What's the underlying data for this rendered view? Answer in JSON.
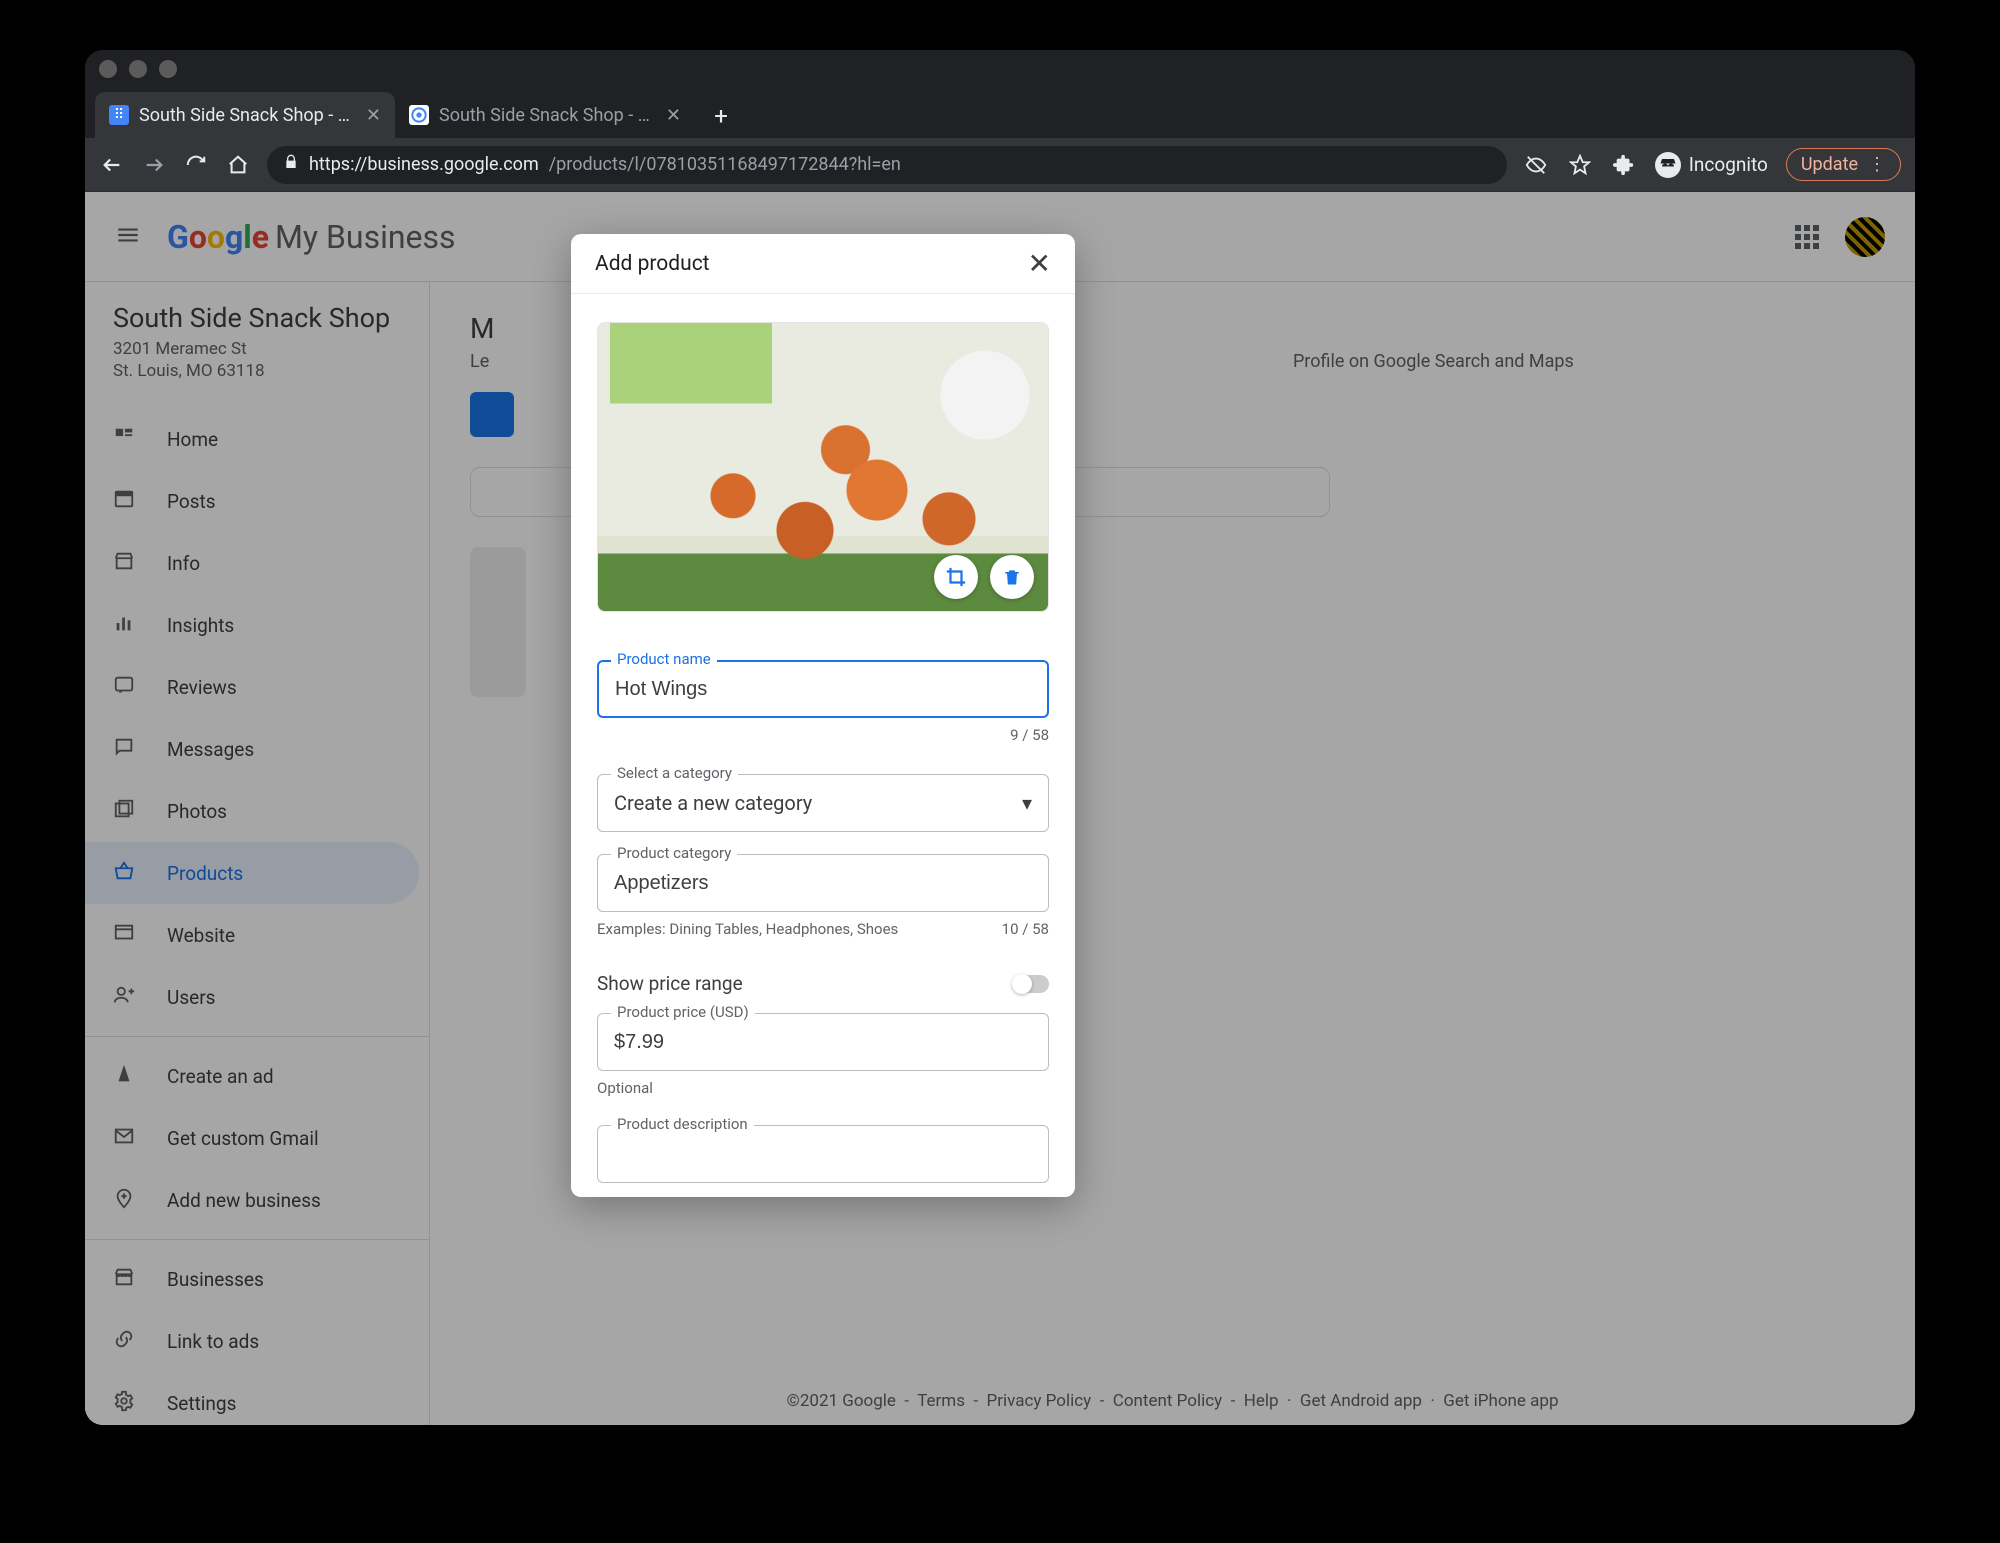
{
  "browser": {
    "tabs": [
      {
        "label": "South Side Snack Shop - Produ",
        "active": true
      },
      {
        "label": "South Side Snack Shop - Goog",
        "active": false
      }
    ],
    "url_host": "https://business.google.com",
    "url_path": "/products/l/07810351168497172844?hl=en",
    "incognito_label": "Incognito",
    "update_label": "Update"
  },
  "header": {
    "logo_text": "Google",
    "product_name": "My Business"
  },
  "business": {
    "name": "South Side Snack Shop",
    "addr1": "3201 Meramec St",
    "addr2": "St. Louis, MO 63118"
  },
  "nav": {
    "home": "Home",
    "posts": "Posts",
    "info": "Info",
    "insights": "Insights",
    "reviews": "Reviews",
    "messages": "Messages",
    "photos": "Photos",
    "products": "Products",
    "website": "Website",
    "users": "Users",
    "create_ad": "Create an ad",
    "custom_gmail": "Get custom Gmail",
    "add_business": "Add new business",
    "businesses": "Businesses",
    "link_ads": "Link to ads",
    "settings": "Settings"
  },
  "main": {
    "heading_hidden": "M",
    "sub_visible": "Le",
    "sub_right": "Profile on Google Search and Maps"
  },
  "dialog": {
    "title": "Add product",
    "product_name_label": "Product name",
    "product_name_value": "Hot Wings",
    "product_name_counter": "9 / 58",
    "select_category_label": "Select a category",
    "select_category_value": "Create a new category",
    "product_category_label": "Product category",
    "product_category_value": "Appetizers",
    "product_category_examples": "Examples: Dining Tables, Headphones, Shoes",
    "product_category_counter": "10 / 58",
    "show_price_range": "Show price range",
    "price_label": "Product price (USD)",
    "price_value": "$7.99",
    "optional": "Optional",
    "description_label": "Product description"
  },
  "footer": {
    "copyright": "©2021 Google",
    "terms": "Terms",
    "privacy": "Privacy Policy",
    "content": "Content Policy",
    "help": "Help",
    "android": "Get Android app",
    "iphone": "Get iPhone app"
  }
}
